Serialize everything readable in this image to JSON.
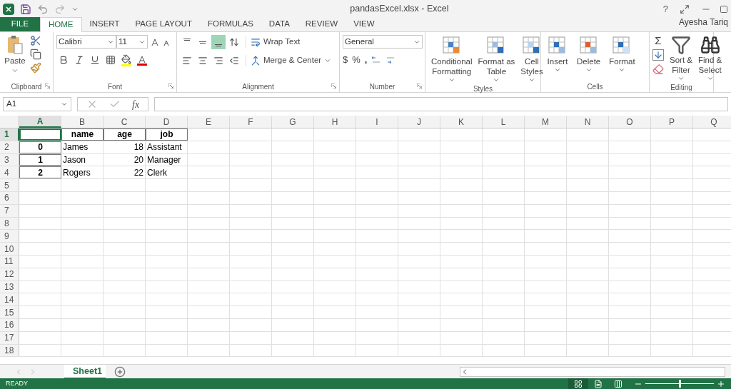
{
  "window": {
    "title": "pandasExcel.xlsx - Excel",
    "help": "?",
    "user": "Ayesha Tariq"
  },
  "tabs": [
    {
      "label": "FILE",
      "kind": "file",
      "selected": false
    },
    {
      "label": "HOME",
      "kind": "tab",
      "selected": true
    },
    {
      "label": "INSERT",
      "kind": "tab",
      "selected": false
    },
    {
      "label": "PAGE LAYOUT",
      "kind": "tab",
      "selected": false
    },
    {
      "label": "FORMULAS",
      "kind": "tab",
      "selected": false
    },
    {
      "label": "DATA",
      "kind": "tab",
      "selected": false
    },
    {
      "label": "REVIEW",
      "kind": "tab",
      "selected": false
    },
    {
      "label": "VIEW",
      "kind": "tab",
      "selected": false
    }
  ],
  "ribbon": {
    "clipboard": {
      "label": "Clipboard",
      "paste": "Paste"
    },
    "font": {
      "label": "Font",
      "font_name": "Calibri",
      "font_size": "11"
    },
    "alignment": {
      "label": "Alignment",
      "vertical": [
        {
          "selected": false
        },
        {
          "selected": false
        },
        {
          "selected": true
        }
      ],
      "wrap_text": "Wrap Text",
      "merge": "Merge & Center"
    },
    "number": {
      "label": "Number",
      "format": "General",
      "currency": "$",
      "percent": "%",
      "comma": ","
    },
    "styles": {
      "label": "Styles",
      "buttons": [
        {
          "lines": [
            "Conditional",
            "Formatting"
          ]
        },
        {
          "lines": [
            "Format as",
            "Table"
          ]
        },
        {
          "lines": [
            "Cell",
            "Styles"
          ]
        }
      ]
    },
    "cells": {
      "label": "Cells",
      "buttons": [
        {
          "lines": [
            "Insert"
          ]
        },
        {
          "lines": [
            "Delete"
          ]
        },
        {
          "lines": [
            "Format"
          ]
        }
      ]
    },
    "editing": {
      "label": "Editing",
      "sum": "Σ",
      "buttons": [
        {
          "lines": [
            "Sort &",
            "Filter"
          ]
        },
        {
          "lines": [
            "Find &",
            "Select"
          ]
        }
      ]
    }
  },
  "formula_bar": {
    "name_box": "A1",
    "fx": "fx"
  },
  "sheet": {
    "columns": [
      {
        "label": "A",
        "selected": true
      },
      {
        "label": "B",
        "selected": false
      },
      {
        "label": "C",
        "selected": false
      },
      {
        "label": "D",
        "selected": false
      },
      {
        "label": "E",
        "selected": false
      },
      {
        "label": "F",
        "selected": false
      },
      {
        "label": "G",
        "selected": false
      },
      {
        "label": "H",
        "selected": false
      },
      {
        "label": "I",
        "selected": false
      },
      {
        "label": "J",
        "selected": false
      },
      {
        "label": "K",
        "selected": false
      },
      {
        "label": "L",
        "selected": false
      },
      {
        "label": "M",
        "selected": false
      },
      {
        "label": "N",
        "selected": false
      },
      {
        "label": "O",
        "selected": false
      },
      {
        "label": "P",
        "selected": false
      },
      {
        "label": "Q",
        "selected": false
      }
    ],
    "rows": [
      {
        "label": "1",
        "selected": true,
        "kind": "header",
        "cells": [
          "",
          "name",
          "age",
          "job"
        ]
      },
      {
        "label": "2",
        "selected": false,
        "kind": "data",
        "cells": [
          "0",
          "James",
          "18",
          "Assistant"
        ]
      },
      {
        "label": "3",
        "selected": false,
        "kind": "data",
        "cells": [
          "1",
          "Jason",
          "20",
          "Manager"
        ]
      },
      {
        "label": "4",
        "selected": false,
        "kind": "data",
        "cells": [
          "2",
          "Rogers",
          "22",
          "Clerk"
        ]
      },
      {
        "label": "5",
        "selected": false,
        "kind": "empty",
        "cells": []
      },
      {
        "label": "6",
        "selected": false,
        "kind": "empty",
        "cells": []
      },
      {
        "label": "7",
        "selected": false,
        "kind": "empty",
        "cells": []
      },
      {
        "label": "8",
        "selected": false,
        "kind": "empty",
        "cells": []
      },
      {
        "label": "9",
        "selected": false,
        "kind": "empty",
        "cells": []
      },
      {
        "label": "10",
        "selected": false,
        "kind": "empty",
        "cells": []
      },
      {
        "label": "11",
        "selected": false,
        "kind": "empty",
        "cells": []
      },
      {
        "label": "12",
        "selected": false,
        "kind": "empty",
        "cells": []
      },
      {
        "label": "13",
        "selected": false,
        "kind": "empty",
        "cells": []
      },
      {
        "label": "14",
        "selected": false,
        "kind": "empty",
        "cells": []
      },
      {
        "label": "15",
        "selected": false,
        "kind": "empty",
        "cells": []
      },
      {
        "label": "16",
        "selected": false,
        "kind": "empty",
        "cells": []
      },
      {
        "label": "17",
        "selected": false,
        "kind": "empty",
        "cells": []
      },
      {
        "label": "18",
        "selected": false,
        "kind": "empty",
        "cells": []
      }
    ]
  },
  "sheet_tabs": [
    {
      "label": "Sheet1",
      "selected": true
    }
  ],
  "status_bar": {
    "status": "READY",
    "zoom": {
      "level": 0.5
    },
    "views": [
      {
        "selected": true
      },
      {
        "selected": false
      },
      {
        "selected": false
      }
    ]
  }
}
